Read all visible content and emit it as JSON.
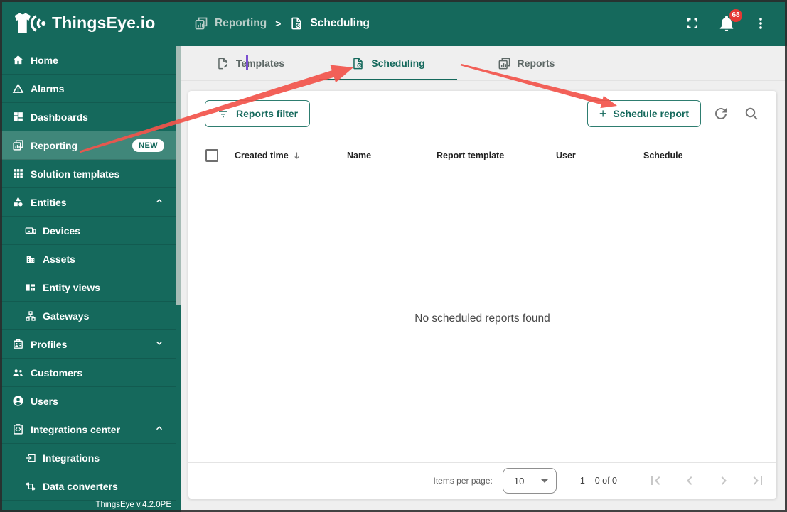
{
  "header": {
    "logo_text": "ThingsEye.io",
    "breadcrumb": {
      "parent_label": "Reporting",
      "separator": ">",
      "current_label": "Scheduling"
    },
    "notification_count": "68"
  },
  "sidebar": {
    "items": [
      {
        "label": "Home"
      },
      {
        "label": "Alarms"
      },
      {
        "label": "Dashboards"
      },
      {
        "label": "Reporting",
        "badge": "NEW",
        "selected": true
      },
      {
        "label": "Solution templates"
      },
      {
        "label": "Entities",
        "chevron": "up",
        "expanded": true
      },
      {
        "label": "Devices",
        "indent": true
      },
      {
        "label": "Assets",
        "indent": true
      },
      {
        "label": "Entity views",
        "indent": true
      },
      {
        "label": "Gateways",
        "indent": true
      },
      {
        "label": "Profiles",
        "chevron": "down",
        "expanded": false
      },
      {
        "label": "Customers"
      },
      {
        "label": "Users"
      },
      {
        "label": "Integrations center",
        "chevron": "up",
        "expanded": true
      },
      {
        "label": "Integrations",
        "indent": true
      },
      {
        "label": "Data converters",
        "indent": true
      }
    ],
    "version": "ThingsEye v.4.2.0PE"
  },
  "tabs": {
    "items": [
      {
        "label": "Templates",
        "active": false
      },
      {
        "label": "Scheduling",
        "active": true
      },
      {
        "label": "Reports",
        "active": false
      }
    ]
  },
  "toolbar": {
    "filter_button_label": "Reports filter",
    "schedule_button_plus": "+",
    "schedule_button_label": "Schedule report"
  },
  "table": {
    "select_all_checked": false,
    "columns": [
      {
        "label": "Created time",
        "sort": "desc"
      },
      {
        "label": "Name"
      },
      {
        "label": "Report template"
      },
      {
        "label": "User"
      },
      {
        "label": "Schedule"
      }
    ],
    "empty_message": "No scheduled reports found"
  },
  "pagination": {
    "items_per_page_label": "Items per page:",
    "page_size_value": "10",
    "range_label": "1 – 0 of 0"
  },
  "colors": {
    "primary_teal": "#15695c",
    "sidebar_selected": "#40877a",
    "annotation_red": "#f2544b",
    "badge_red": "#e53935"
  }
}
